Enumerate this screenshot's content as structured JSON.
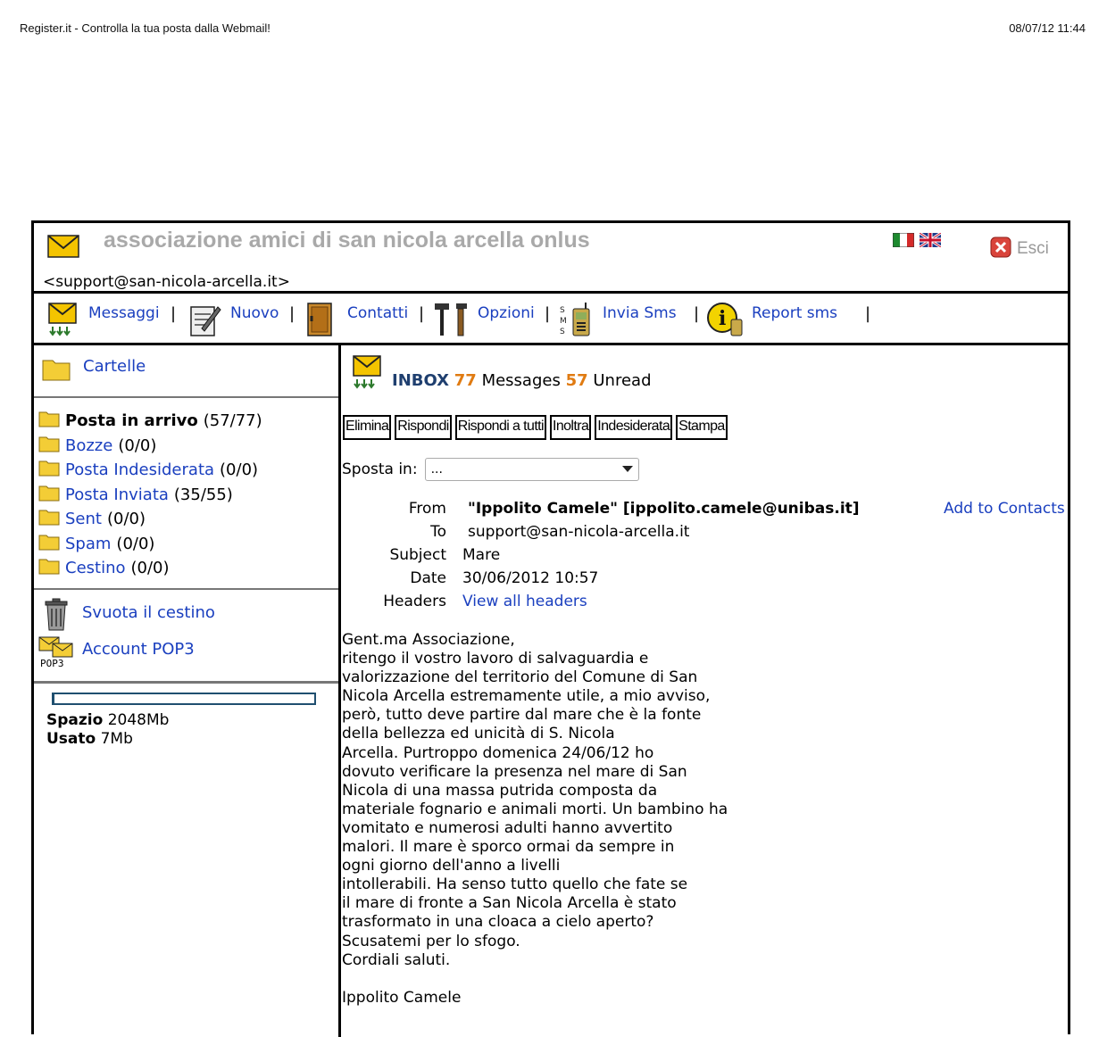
{
  "print_header": {
    "title": "Register.it - Controlla la tua posta dalla Webmail!",
    "datetime": "08/07/12 11:44"
  },
  "top": {
    "org_name": "associazione amici di san nicola arcella onlus",
    "email": "<support@san-nicola-arcella.it>",
    "logout_label": "Esci"
  },
  "nav": {
    "messages": "Messaggi",
    "new": "Nuovo",
    "contacts": "Contatti",
    "options": "Opzioni",
    "send_sms": "Invia Sms",
    "report_sms": "Report sms",
    "sep": "|"
  },
  "sidebar": {
    "folders_title": "Cartelle",
    "folders": [
      {
        "name": "Posta in arrivo",
        "count": "(57/77)"
      },
      {
        "name": "Bozze",
        "count": "(0/0)"
      },
      {
        "name": "Posta Indesiderata",
        "count": "(0/0)"
      },
      {
        "name": "Posta Inviata",
        "count": "(35/55)"
      },
      {
        "name": "Sent",
        "count": "(0/0)"
      },
      {
        "name": "Spam",
        "count": "(0/0)"
      },
      {
        "name": "Cestino",
        "count": "(0/0)"
      }
    ],
    "empty_trash": "Svuota il cestino",
    "pop3_account": "Account POP3",
    "pop3_icon_label": "POP3",
    "quota": {
      "space_label": "Spazio",
      "space_value": "2048Mb",
      "used_label": "Usato",
      "used_value": "7Mb",
      "used_fraction": 0.0034
    }
  },
  "main": {
    "inbox_label": "INBOX",
    "total": "77",
    "messages_label": "Messages",
    "unread": "57",
    "unread_label": "Unread",
    "buttons": [
      "Elimina",
      "Rispondi",
      "Rispondi a tutti",
      "Inoltra",
      "Indesiderata",
      "Stampa"
    ],
    "move_label": "Sposta in:",
    "move_value": "...",
    "headers": {
      "from_label": "From",
      "from_value": "\"Ippolito Camele\" [ippolito.camele@unibas.it]",
      "add_contact": "Add to Contacts",
      "to_label": "To",
      "to_value": "support@san-nicola-arcella.it",
      "subject_label": "Subject",
      "subject_value": "Mare",
      "date_label": "Date",
      "date_value": "30/06/2012 10:57",
      "headers_label": "Headers",
      "headers_value": "View all headers"
    },
    "body": "Gent.ma Associazione,\nritengo il vostro lavoro di salvaguardia e\nvalorizzazione del territorio del Comune di San\nNicola Arcella estremamente utile, a mio avviso,\nperò, tutto deve partire dal mare che è la fonte\ndella bellezza ed unicità di S. Nicola\nArcella. Purtroppo domenica 24/06/12 ho\ndovuto verificare la presenza nel mare di San\nNicola di una massa putrida composta da\nmateriale fognario e animali morti. Un bambino ha\nvomitato e numerosi adulti hanno avvertito\nmalori. Il mare è sporco ormai da sempre in\nogni giorno dell'anno a livelli\nintollerabili. Ha senso tutto quello che fate se\nil mare di fronte a San Nicola Arcella è stato\ntrasformato in una cloaca a cielo aperto?\nScusatemi per lo sfogo.\nCordiali saluti.\n\nIppolito Camele"
  }
}
